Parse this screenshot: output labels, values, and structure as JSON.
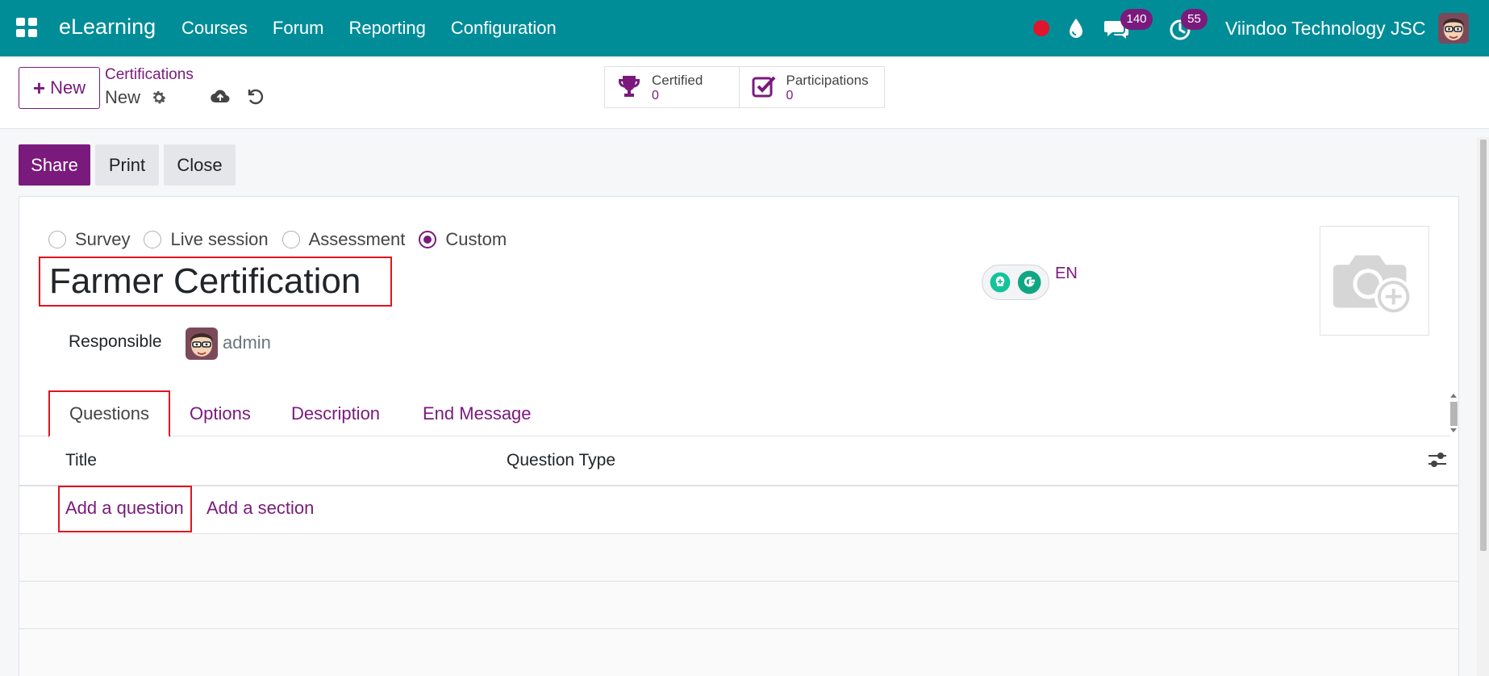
{
  "navbar": {
    "brand": "eLearning",
    "menu": [
      "Courses",
      "Forum",
      "Reporting",
      "Configuration"
    ],
    "messages_count": "140",
    "activities_count": "55",
    "company": "Viindoo Technology JSC",
    "colors": {
      "bar": "#018d98",
      "badge": "#7a1a7d",
      "recording": "#e0142d"
    }
  },
  "control_panel": {
    "new_label": "New",
    "breadcrumb": "Certifications",
    "record_name": "New",
    "stats": [
      {
        "label": "Certified",
        "value": "0",
        "icon": "trophy-icon"
      },
      {
        "label": "Participations",
        "value": "0",
        "icon": "checkbox-icon"
      }
    ]
  },
  "actions": {
    "share": "Share",
    "print": "Print",
    "close": "Close"
  },
  "form": {
    "survey_types": [
      {
        "label": "Survey",
        "checked": false
      },
      {
        "label": "Live session",
        "checked": false
      },
      {
        "label": "Assessment",
        "checked": false
      },
      {
        "label": "Custom",
        "checked": true
      }
    ],
    "title": "Farmer Certification",
    "language": "EN",
    "responsible_label": "Responsible",
    "responsible_name": "admin"
  },
  "tabs": [
    "Questions",
    "Options",
    "Description",
    "End Message"
  ],
  "questions_table": {
    "columns": [
      "Title",
      "Question Type"
    ],
    "add_question": "Add a question",
    "add_section": "Add a section",
    "rows": []
  },
  "accent_color": "#7a1a7d",
  "highlight_color": "#e0141e"
}
